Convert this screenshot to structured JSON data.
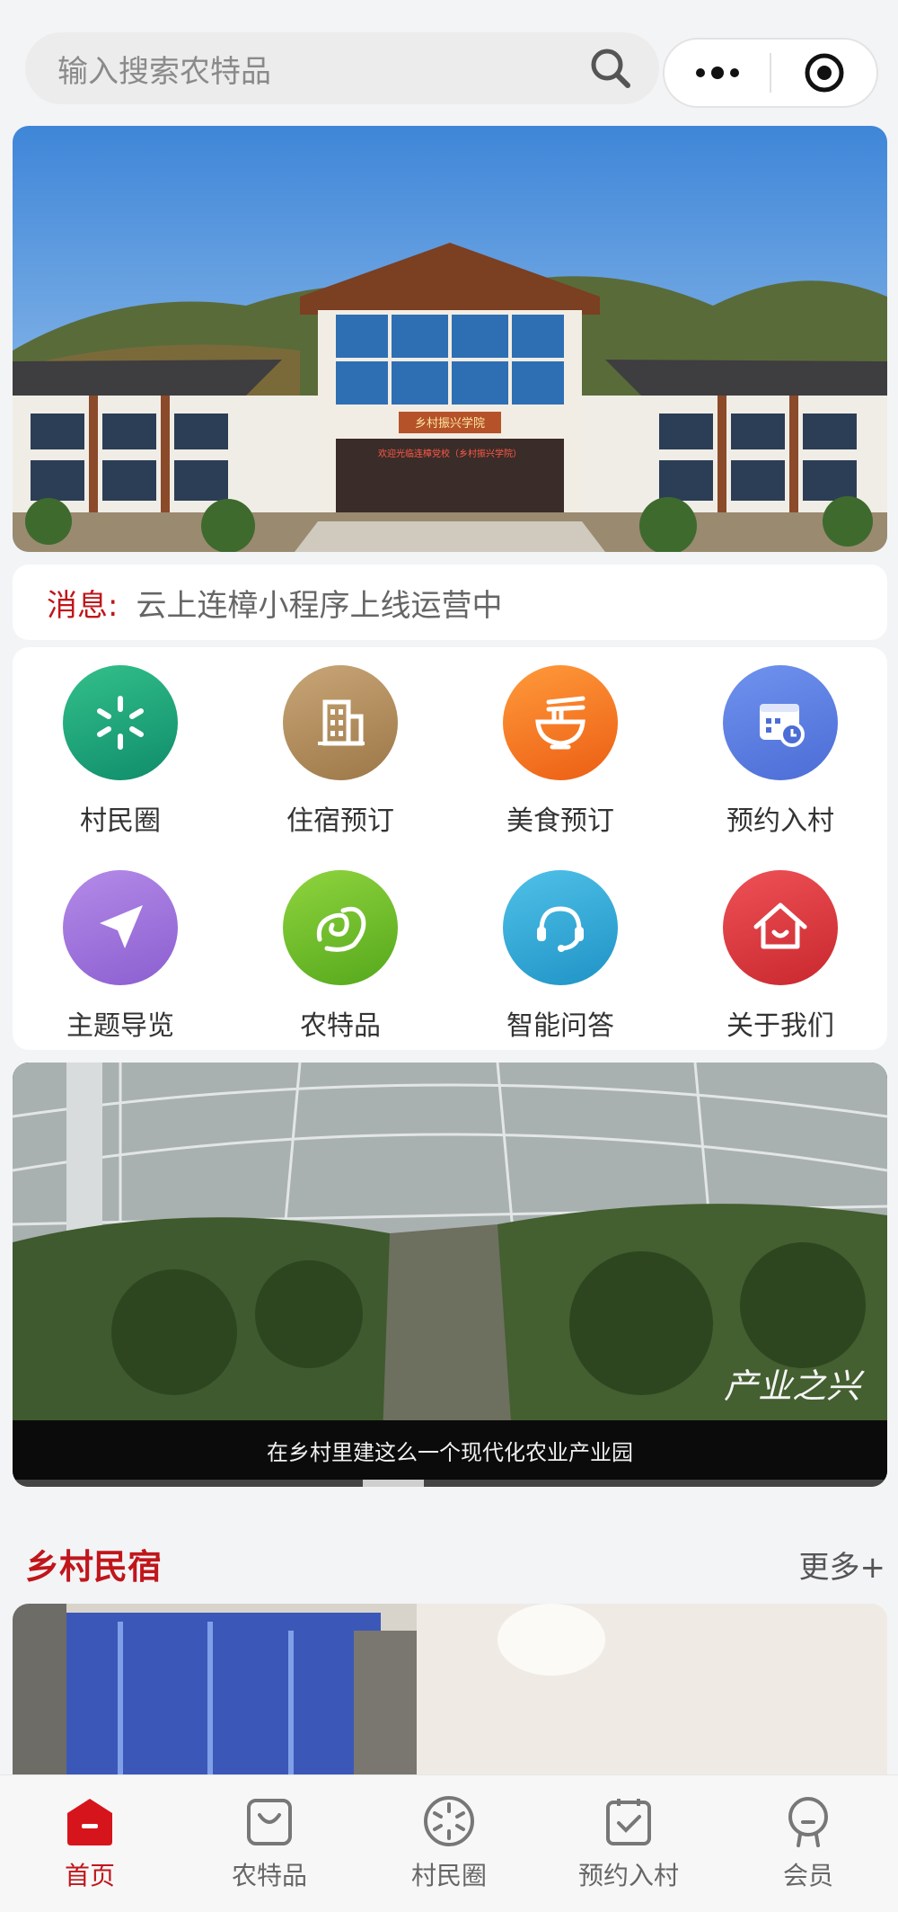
{
  "search": {
    "placeholder": "输入搜索农特品"
  },
  "capsule": {
    "more_icon": "more-dots-icon",
    "close_icon": "target-circle-icon"
  },
  "notice": {
    "label": "消息:",
    "text": "云上连樟小程序上线运营中"
  },
  "grid": {
    "items": [
      {
        "label": "村民圈",
        "icon": "villager-circle-icon",
        "color": "#1aa37a"
      },
      {
        "label": "住宿预订",
        "icon": "building-icon",
        "color": "#b28d5f"
      },
      {
        "label": "美食预订",
        "icon": "noodle-bowl-icon",
        "color": "#f17322"
      },
      {
        "label": "预约入村",
        "icon": "calendar-clock-icon",
        "color": "#5a7de6"
      },
      {
        "label": "主题导览",
        "icon": "navigation-arrow-icon",
        "color": "#9b70db"
      },
      {
        "label": "农特品",
        "icon": "swirl-leaf-icon",
        "color": "#6dbd2a"
      },
      {
        "label": "智能问答",
        "icon": "headset-icon",
        "color": "#2ea8d8"
      },
      {
        "label": "关于我们",
        "icon": "house-icon",
        "color": "#db3a3e"
      }
    ]
  },
  "video": {
    "caption": "在乡村里建这么一个现代化农业产业园",
    "watermark": "产业之兴",
    "progress": 0.07
  },
  "section": {
    "title": "乡村民宿",
    "more": "更多+"
  },
  "tabbar": {
    "items": [
      {
        "label": "首页",
        "icon": "home-icon",
        "active": true
      },
      {
        "label": "农特品",
        "icon": "shopping-bag-icon",
        "active": false
      },
      {
        "label": "村民圈",
        "icon": "villager-circle-icon",
        "active": false
      },
      {
        "label": "预约入村",
        "icon": "calendar-check-icon",
        "active": false
      },
      {
        "label": "会员",
        "icon": "member-icon",
        "active": false
      }
    ]
  },
  "banner_sign": "乡村振兴学院",
  "banner_banner": "欢迎光临连樟党校（乡村振兴学院）",
  "colors": {
    "accent": "#c0161b",
    "background": "#f3f4f6"
  }
}
